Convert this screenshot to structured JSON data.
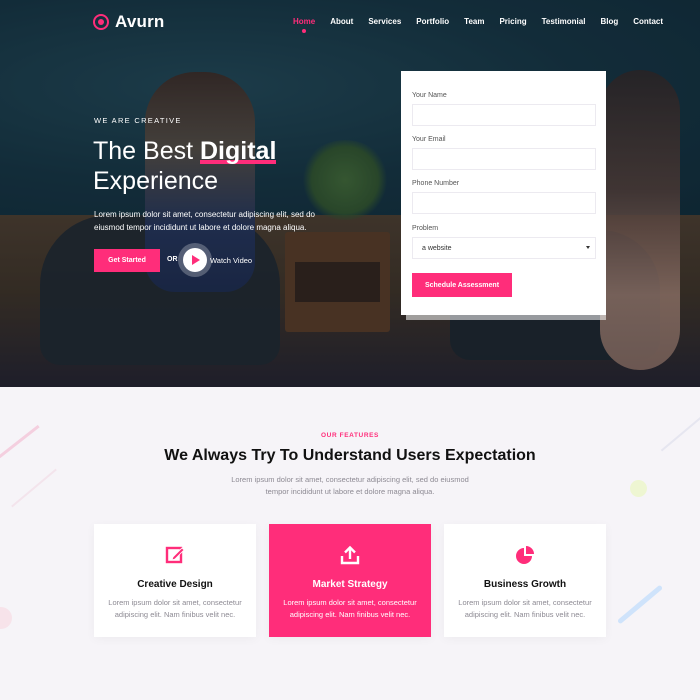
{
  "brand": {
    "name": "Avurn"
  },
  "nav": {
    "items": [
      {
        "label": "Home",
        "active": true
      },
      {
        "label": "About"
      },
      {
        "label": "Services"
      },
      {
        "label": "Portfolio"
      },
      {
        "label": "Team"
      },
      {
        "label": "Pricing"
      },
      {
        "label": "Testimonial"
      },
      {
        "label": "Blog"
      },
      {
        "label": "Contact"
      }
    ]
  },
  "hero": {
    "eyebrow": "WE ARE CREATIVE",
    "headline_part1": "The Best ",
    "headline_highlight": "Digital",
    "headline_part2": "Experience",
    "description": "Lorem ipsum dolor sit amet, consectetur adipiscing elit, sed do eiusmod tempor incididunt ut labore et dolore magna aliqua.",
    "cta_label": "Get Started",
    "or_label": "OR",
    "video_label": "Watch Video"
  },
  "form": {
    "name_label": "Your Name",
    "email_label": "Your Email",
    "phone_label": "Phone Number",
    "problem_label": "Problem",
    "problem_selected": "a website",
    "submit_label": "Schedule Assessment"
  },
  "features": {
    "eyebrow": "OUR FEATURES",
    "title_part1": "We Always Try To ",
    "title_highlight": "Understand",
    "title_part2": " Users Expectation",
    "description": "Lorem ipsum dolor sit amet, consectetur adipiscing elit, sed do eiusmod tempor incididunt ut labore et dolore magna aliqua.",
    "cards": [
      {
        "icon": "edit-icon",
        "title": "Creative Design",
        "text": "Lorem ipsum dolor sit amet, consectetur adipiscing elit. Nam finibus velit nec."
      },
      {
        "icon": "upload-icon",
        "title": "Market Strategy",
        "text": "Lorem ipsum dolor sit amet, consectetur adipiscing elit. Nam finibus velit nec.",
        "active": true
      },
      {
        "icon": "pie-chart-icon",
        "title": "Business Growth",
        "text": "Lorem ipsum dolor sit amet, consectetur adipiscing elit. Nam finibus velit nec."
      }
    ]
  },
  "colors": {
    "accent": "#ff2d7a",
    "hero_bg": "#173543",
    "section_bg": "#f6f4f8"
  }
}
